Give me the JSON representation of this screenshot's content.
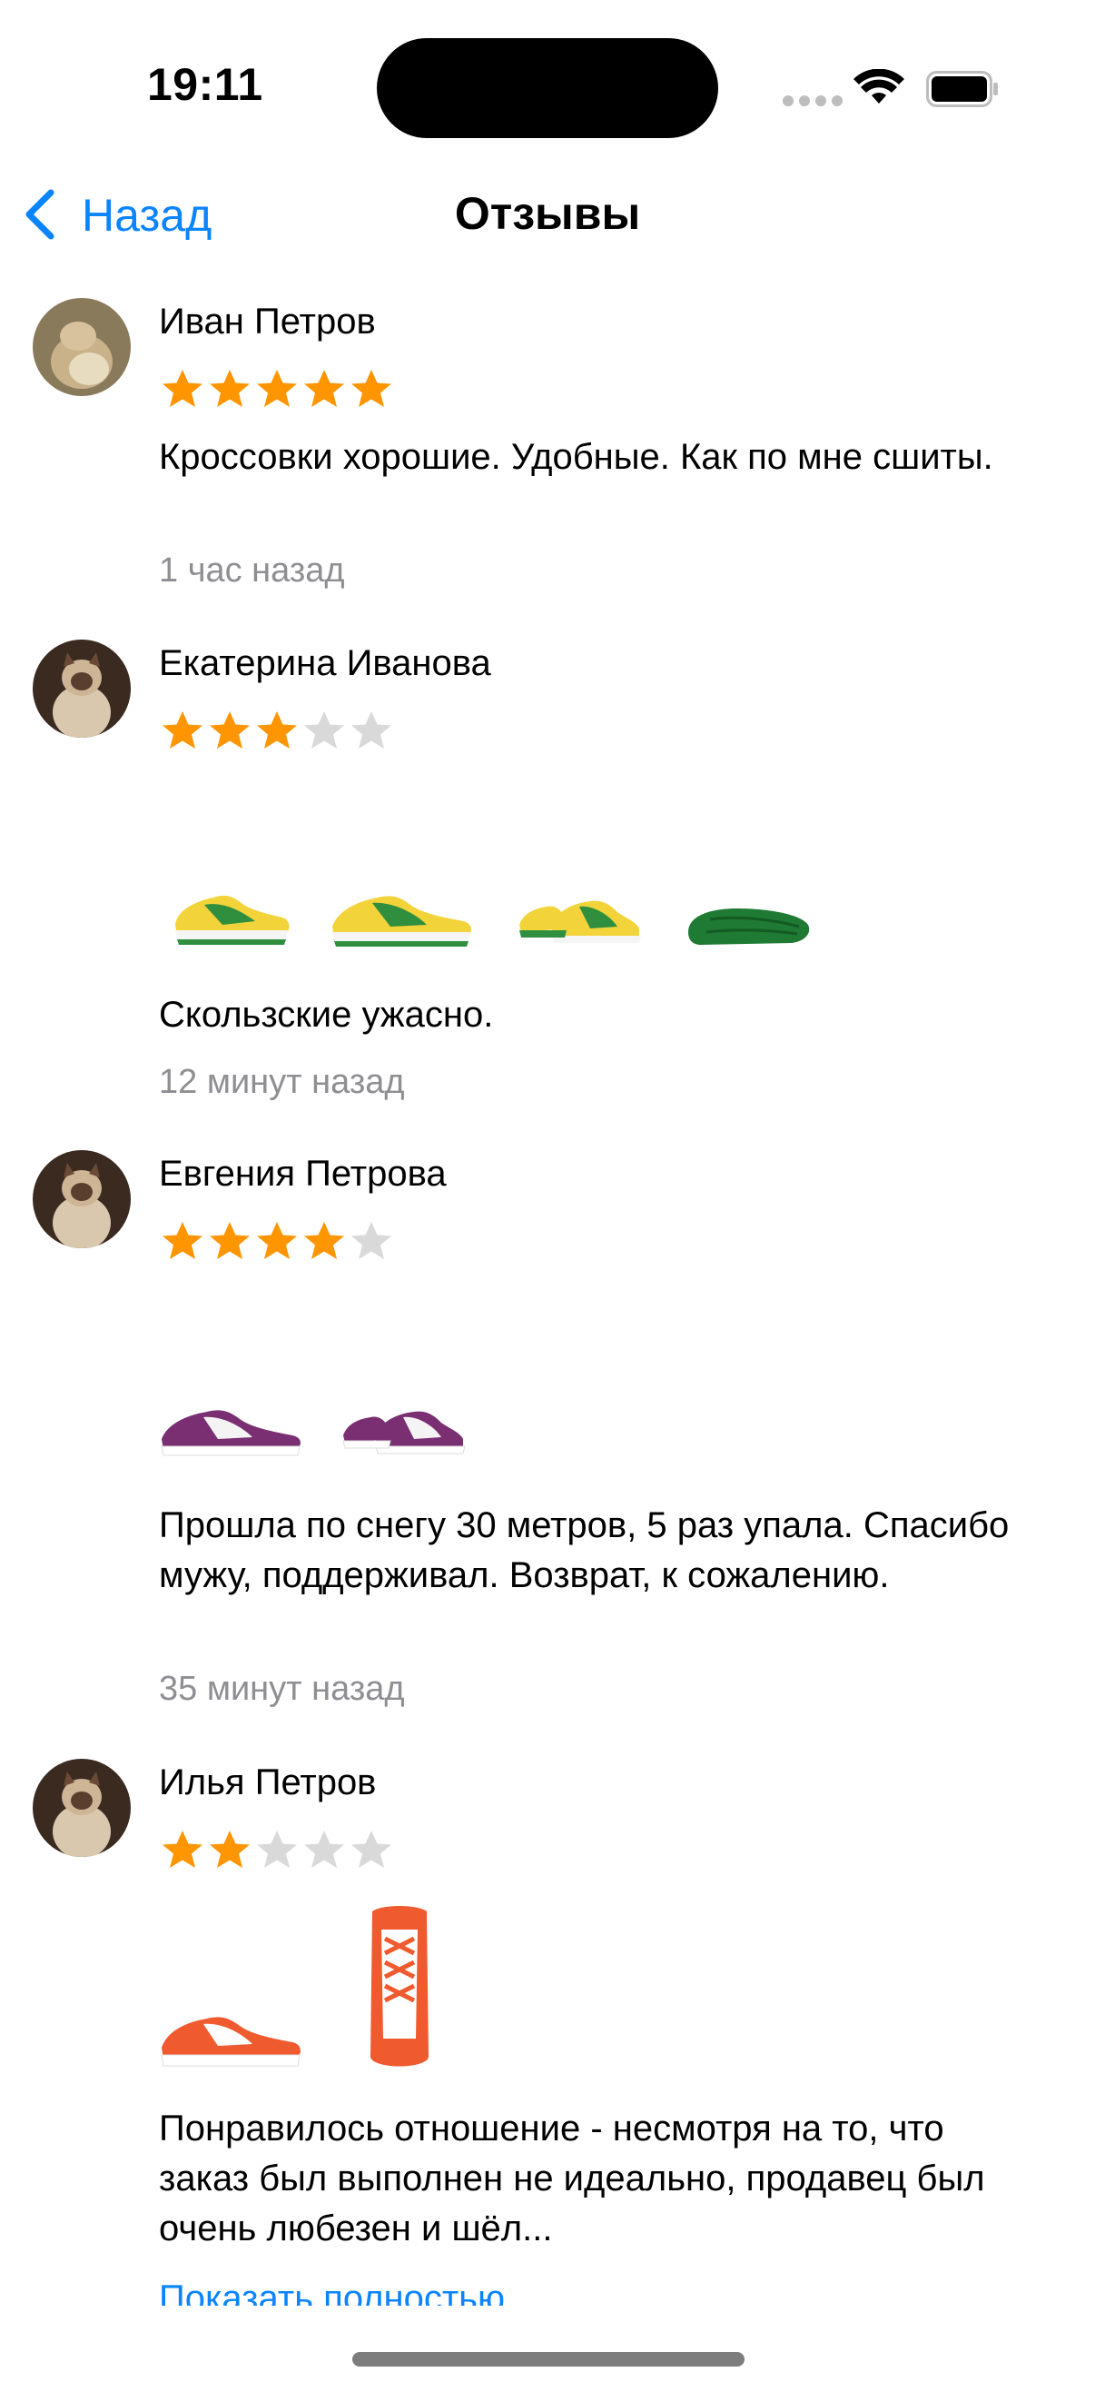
{
  "status_bar": {
    "time": "19:11"
  },
  "nav": {
    "back_label": "Назад",
    "title": "Отзывы"
  },
  "colors": {
    "accent": "#0a84ff",
    "star_filled": "#ff9500",
    "star_empty": "#d9d9d9",
    "secondary_text": "#8e8e93"
  },
  "reviews": [
    {
      "name": "Иван Петров",
      "rating": 5,
      "text": "Кроссовки хорошие. Удобные. Как по мне сшиты.",
      "time": "1 час назад",
      "photos": []
    },
    {
      "name": "Екатерина Иванова",
      "rating": 3,
      "text": "Скользские ужасно.",
      "time": "12 минут назад",
      "photos": [
        "green-yellow-sneaker",
        "green-yellow-sneaker",
        "green-yellow-sneaker-pair",
        "green-sole"
      ]
    },
    {
      "name": "Евгения Петрова",
      "rating": 4,
      "text": "Прошла по снегу 30 метров, 5 раз упала. Спасибо мужу, поддерживал. Возврат, к сожалению.",
      "time": "35 минут назад",
      "photos": [
        "purple-sneaker",
        "purple-sneaker-pair"
      ]
    },
    {
      "name": "Илья Петров",
      "rating": 2,
      "text": "Понравилось отношение - несмотря на то, что заказ был выполнен не идеально, продавец был очень любезен и шёл...",
      "more_label": "Показать полностью",
      "photos": [
        "orange-sneaker",
        "orange-sneaker-top"
      ]
    }
  ]
}
